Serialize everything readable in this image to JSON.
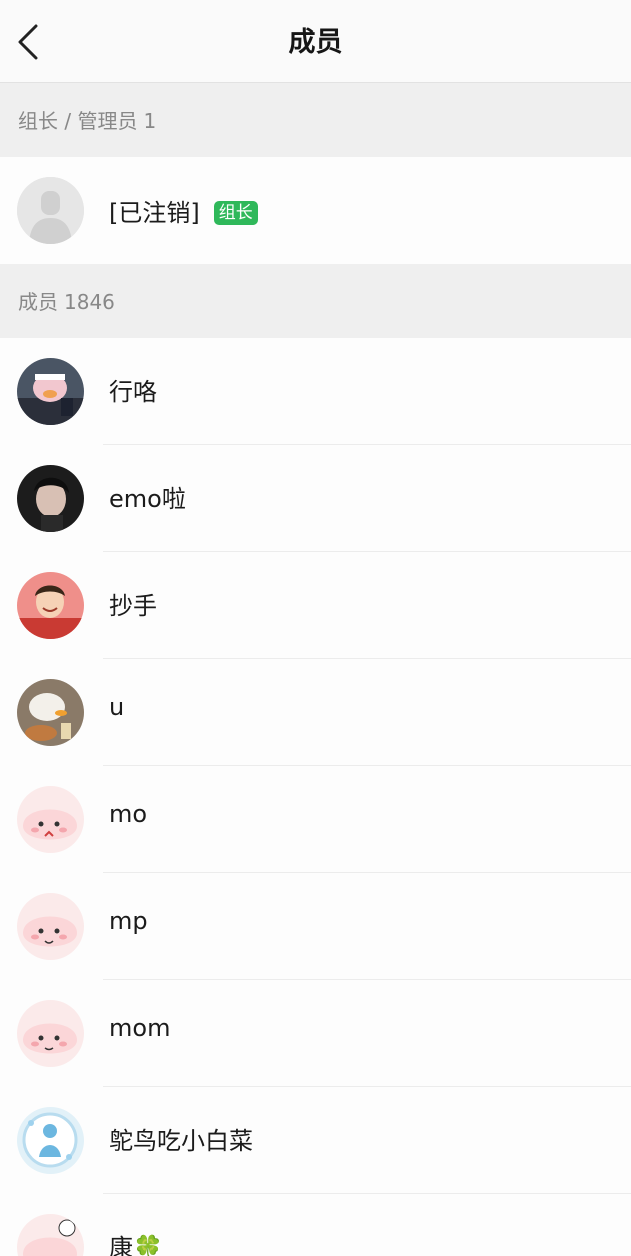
{
  "header": {
    "title": "成员"
  },
  "admins_section": {
    "label": "组长 / 管理员",
    "count": "1"
  },
  "owner": {
    "name": "[已注销]",
    "badge": "组长"
  },
  "members_section": {
    "label": "成员",
    "count": "1846"
  },
  "members": [
    {
      "name": "行咯"
    },
    {
      "name": "emo啦"
    },
    {
      "name": "抄手"
    },
    {
      "name": "u"
    },
    {
      "name": "mo"
    },
    {
      "name": "mp"
    },
    {
      "name": "mom"
    },
    {
      "name": "鸵鸟吃小白菜"
    },
    {
      "name": "康🍀"
    }
  ],
  "colors": {
    "badge": "#2fb85a",
    "section_bg": "#efefef",
    "section_text": "#888888"
  }
}
